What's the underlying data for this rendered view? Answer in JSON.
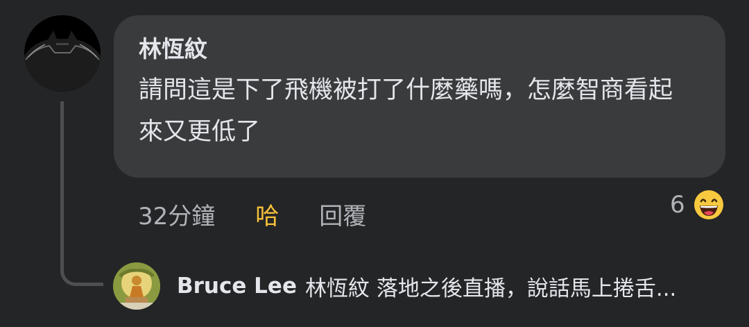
{
  "comment": {
    "author": "林恆紋",
    "text": "請問這是下了飛機被打了什麼藥嗎，怎麼智商看起來又更低了",
    "avatar_icon": "batman-silhouette-avatar"
  },
  "actions": {
    "time": "32分鐘",
    "like_label": "哈",
    "reply_label": "回覆",
    "like_color": "#f7c13a"
  },
  "reactions": {
    "count": "6",
    "icon": "haha-emoji-icon"
  },
  "reply_preview": {
    "author": "Bruce Lee",
    "text": "林恆紋 落地之後直播，說話馬上捲舌..."
  },
  "colors": {
    "background": "#242526",
    "bubble": "#3a3b3c",
    "text": "#e4e6eb",
    "muted": "#b0b3b8"
  }
}
